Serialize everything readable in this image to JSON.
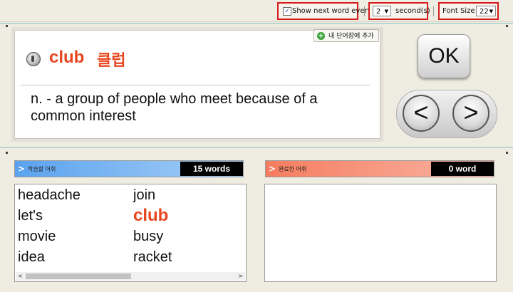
{
  "toolbar": {
    "show_next_label": "Show next word every",
    "show_next_checked": true,
    "seconds_value": "2",
    "seconds_label": "second(s)",
    "font_size_label": "Font Size",
    "font_size_value": "22"
  },
  "card": {
    "word": "club",
    "korean": "클럽",
    "definition": "n. - a group of people who meet because of a common interest",
    "add_button_label": "내 단어장에 추가"
  },
  "controls": {
    "ok_label": "OK",
    "prev_label": "<",
    "next_label": ">"
  },
  "learning": {
    "label": "학습할 어휘",
    "count": "15 words",
    "head_color": "#5aa2ee",
    "words": [
      "headache",
      "join",
      "let's",
      "club",
      "movie",
      "busy",
      "idea",
      "racket"
    ],
    "active_word": "club"
  },
  "completed": {
    "label": "완료한 어휘",
    "count": "0 word",
    "head_color": "#f57c5f"
  },
  "colors": {
    "accent": "#e8461f",
    "highlight_box": "#d61b1b",
    "background": "#efece2"
  }
}
